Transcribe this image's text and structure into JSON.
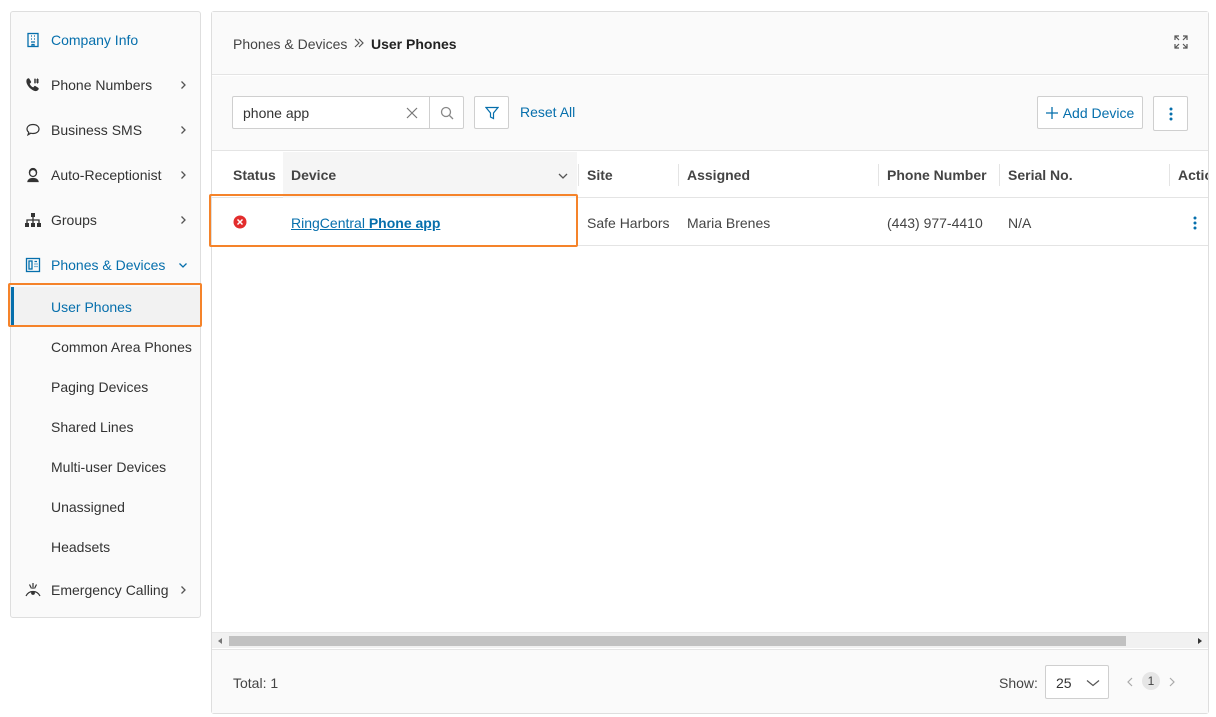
{
  "sidebar": {
    "items": [
      {
        "label": "Company Info",
        "icon": "building-icon"
      },
      {
        "label": "Phone Numbers",
        "icon": "phone-numbers-icon"
      },
      {
        "label": "Business SMS",
        "icon": "chat-bubble-icon"
      },
      {
        "label": "Auto-Receptionist",
        "icon": "receptionist-icon"
      },
      {
        "label": "Groups",
        "icon": "groups-icon"
      },
      {
        "label": "Phones & Devices",
        "icon": "desk-phone-icon"
      },
      {
        "label": "Emergency Calling",
        "icon": "emergency-icon"
      }
    ],
    "sub_items": [
      {
        "label": "User Phones"
      },
      {
        "label": "Common Area Phones"
      },
      {
        "label": "Paging Devices"
      },
      {
        "label": "Shared Lines"
      },
      {
        "label": "Multi-user Devices"
      },
      {
        "label": "Unassigned"
      },
      {
        "label": "Headsets"
      }
    ]
  },
  "breadcrumb": {
    "parent": "Phones & Devices",
    "current": "User Phones"
  },
  "toolbar": {
    "search_value": "phone app",
    "reset_all": "Reset All",
    "add_device": "Add Device"
  },
  "table": {
    "columns": [
      "Status",
      "Device",
      "Site",
      "Assigned",
      "Phone Number",
      "Serial No.",
      "Actio"
    ],
    "rows": [
      {
        "status": "error",
        "device_prefix": "RingCentral",
        "device_name": "Phone app",
        "site": "Safe Harbors",
        "assigned": "Maria Brenes",
        "phone_number": "(443) 977-4410",
        "serial_no": "N/A"
      }
    ]
  },
  "footer": {
    "total": "Total: 1",
    "show_label": "Show:",
    "page_size": "25",
    "current_page": "1"
  },
  "colors": {
    "accent": "#066fac",
    "highlight": "#f5832a",
    "status_error": "#e32d2d"
  }
}
